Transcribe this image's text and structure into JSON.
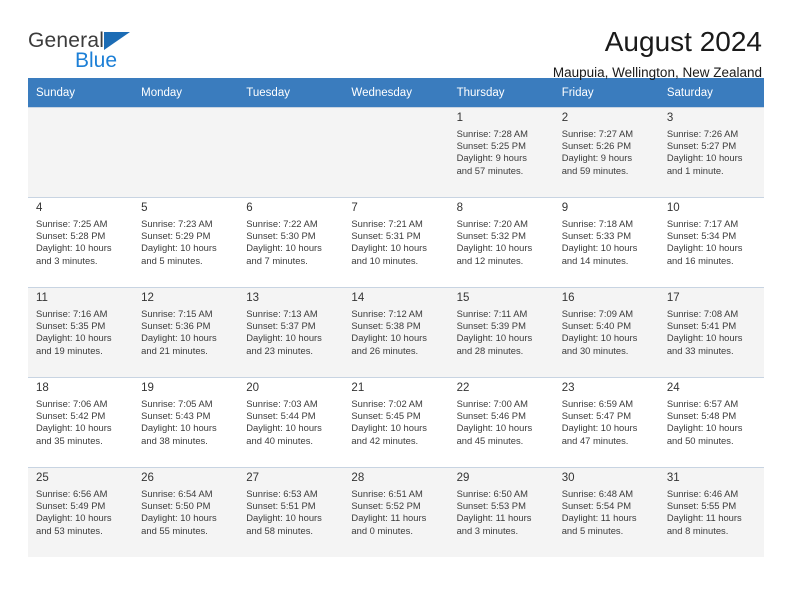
{
  "brand": {
    "name_top": "General",
    "name_bottom": "Blue",
    "triangle_color": "#1c6cb5",
    "blue_color": "#1c7fd6"
  },
  "header": {
    "title": "August 2024",
    "subtitle": "Maupuia, Wellington, New Zealand"
  },
  "theme": {
    "header_row_bg": "#3a7cbe",
    "header_row_text": "#ffffff",
    "alt_row_bg": "#f4f4f4",
    "grid_line": "#c8d4e2"
  },
  "calendar": {
    "weekday_headers": [
      "Sunday",
      "Monday",
      "Tuesday",
      "Wednesday",
      "Thursday",
      "Friday",
      "Saturday"
    ],
    "labels": {
      "sunrise": "Sunrise:",
      "sunset": "Sunset:",
      "daylight": "Daylight:"
    },
    "weeks": [
      [
        {
          "day": "",
          "empty": true
        },
        {
          "day": "",
          "empty": true
        },
        {
          "day": "",
          "empty": true
        },
        {
          "day": "",
          "empty": true
        },
        {
          "day": "1",
          "sunrise": "Sunrise: 7:28 AM",
          "sunset": "Sunset: 5:25 PM",
          "daylight_1": "Daylight: 9 hours",
          "daylight_2": "and 57 minutes."
        },
        {
          "day": "2",
          "sunrise": "Sunrise: 7:27 AM",
          "sunset": "Sunset: 5:26 PM",
          "daylight_1": "Daylight: 9 hours",
          "daylight_2": "and 59 minutes."
        },
        {
          "day": "3",
          "sunrise": "Sunrise: 7:26 AM",
          "sunset": "Sunset: 5:27 PM",
          "daylight_1": "Daylight: 10 hours",
          "daylight_2": "and 1 minute."
        }
      ],
      [
        {
          "day": "4",
          "sunrise": "Sunrise: 7:25 AM",
          "sunset": "Sunset: 5:28 PM",
          "daylight_1": "Daylight: 10 hours",
          "daylight_2": "and 3 minutes."
        },
        {
          "day": "5",
          "sunrise": "Sunrise: 7:23 AM",
          "sunset": "Sunset: 5:29 PM",
          "daylight_1": "Daylight: 10 hours",
          "daylight_2": "and 5 minutes."
        },
        {
          "day": "6",
          "sunrise": "Sunrise: 7:22 AM",
          "sunset": "Sunset: 5:30 PM",
          "daylight_1": "Daylight: 10 hours",
          "daylight_2": "and 7 minutes."
        },
        {
          "day": "7",
          "sunrise": "Sunrise: 7:21 AM",
          "sunset": "Sunset: 5:31 PM",
          "daylight_1": "Daylight: 10 hours",
          "daylight_2": "and 10 minutes."
        },
        {
          "day": "8",
          "sunrise": "Sunrise: 7:20 AM",
          "sunset": "Sunset: 5:32 PM",
          "daylight_1": "Daylight: 10 hours",
          "daylight_2": "and 12 minutes."
        },
        {
          "day": "9",
          "sunrise": "Sunrise: 7:18 AM",
          "sunset": "Sunset: 5:33 PM",
          "daylight_1": "Daylight: 10 hours",
          "daylight_2": "and 14 minutes."
        },
        {
          "day": "10",
          "sunrise": "Sunrise: 7:17 AM",
          "sunset": "Sunset: 5:34 PM",
          "daylight_1": "Daylight: 10 hours",
          "daylight_2": "and 16 minutes."
        }
      ],
      [
        {
          "day": "11",
          "sunrise": "Sunrise: 7:16 AM",
          "sunset": "Sunset: 5:35 PM",
          "daylight_1": "Daylight: 10 hours",
          "daylight_2": "and 19 minutes."
        },
        {
          "day": "12",
          "sunrise": "Sunrise: 7:15 AM",
          "sunset": "Sunset: 5:36 PM",
          "daylight_1": "Daylight: 10 hours",
          "daylight_2": "and 21 minutes."
        },
        {
          "day": "13",
          "sunrise": "Sunrise: 7:13 AM",
          "sunset": "Sunset: 5:37 PM",
          "daylight_1": "Daylight: 10 hours",
          "daylight_2": "and 23 minutes."
        },
        {
          "day": "14",
          "sunrise": "Sunrise: 7:12 AM",
          "sunset": "Sunset: 5:38 PM",
          "daylight_1": "Daylight: 10 hours",
          "daylight_2": "and 26 minutes."
        },
        {
          "day": "15",
          "sunrise": "Sunrise: 7:11 AM",
          "sunset": "Sunset: 5:39 PM",
          "daylight_1": "Daylight: 10 hours",
          "daylight_2": "and 28 minutes."
        },
        {
          "day": "16",
          "sunrise": "Sunrise: 7:09 AM",
          "sunset": "Sunset: 5:40 PM",
          "daylight_1": "Daylight: 10 hours",
          "daylight_2": "and 30 minutes."
        },
        {
          "day": "17",
          "sunrise": "Sunrise: 7:08 AM",
          "sunset": "Sunset: 5:41 PM",
          "daylight_1": "Daylight: 10 hours",
          "daylight_2": "and 33 minutes."
        }
      ],
      [
        {
          "day": "18",
          "sunrise": "Sunrise: 7:06 AM",
          "sunset": "Sunset: 5:42 PM",
          "daylight_1": "Daylight: 10 hours",
          "daylight_2": "and 35 minutes."
        },
        {
          "day": "19",
          "sunrise": "Sunrise: 7:05 AM",
          "sunset": "Sunset: 5:43 PM",
          "daylight_1": "Daylight: 10 hours",
          "daylight_2": "and 38 minutes."
        },
        {
          "day": "20",
          "sunrise": "Sunrise: 7:03 AM",
          "sunset": "Sunset: 5:44 PM",
          "daylight_1": "Daylight: 10 hours",
          "daylight_2": "and 40 minutes."
        },
        {
          "day": "21",
          "sunrise": "Sunrise: 7:02 AM",
          "sunset": "Sunset: 5:45 PM",
          "daylight_1": "Daylight: 10 hours",
          "daylight_2": "and 42 minutes."
        },
        {
          "day": "22",
          "sunrise": "Sunrise: 7:00 AM",
          "sunset": "Sunset: 5:46 PM",
          "daylight_1": "Daylight: 10 hours",
          "daylight_2": "and 45 minutes."
        },
        {
          "day": "23",
          "sunrise": "Sunrise: 6:59 AM",
          "sunset": "Sunset: 5:47 PM",
          "daylight_1": "Daylight: 10 hours",
          "daylight_2": "and 47 minutes."
        },
        {
          "day": "24",
          "sunrise": "Sunrise: 6:57 AM",
          "sunset": "Sunset: 5:48 PM",
          "daylight_1": "Daylight: 10 hours",
          "daylight_2": "and 50 minutes."
        }
      ],
      [
        {
          "day": "25",
          "sunrise": "Sunrise: 6:56 AM",
          "sunset": "Sunset: 5:49 PM",
          "daylight_1": "Daylight: 10 hours",
          "daylight_2": "and 53 minutes."
        },
        {
          "day": "26",
          "sunrise": "Sunrise: 6:54 AM",
          "sunset": "Sunset: 5:50 PM",
          "daylight_1": "Daylight: 10 hours",
          "daylight_2": "and 55 minutes."
        },
        {
          "day": "27",
          "sunrise": "Sunrise: 6:53 AM",
          "sunset": "Sunset: 5:51 PM",
          "daylight_1": "Daylight: 10 hours",
          "daylight_2": "and 58 minutes."
        },
        {
          "day": "28",
          "sunrise": "Sunrise: 6:51 AM",
          "sunset": "Sunset: 5:52 PM",
          "daylight_1": "Daylight: 11 hours",
          "daylight_2": "and 0 minutes."
        },
        {
          "day": "29",
          "sunrise": "Sunrise: 6:50 AM",
          "sunset": "Sunset: 5:53 PM",
          "daylight_1": "Daylight: 11 hours",
          "daylight_2": "and 3 minutes."
        },
        {
          "day": "30",
          "sunrise": "Sunrise: 6:48 AM",
          "sunset": "Sunset: 5:54 PM",
          "daylight_1": "Daylight: 11 hours",
          "daylight_2": "and 5 minutes."
        },
        {
          "day": "31",
          "sunrise": "Sunrise: 6:46 AM",
          "sunset": "Sunset: 5:55 PM",
          "daylight_1": "Daylight: 11 hours",
          "daylight_2": "and 8 minutes."
        }
      ]
    ]
  }
}
